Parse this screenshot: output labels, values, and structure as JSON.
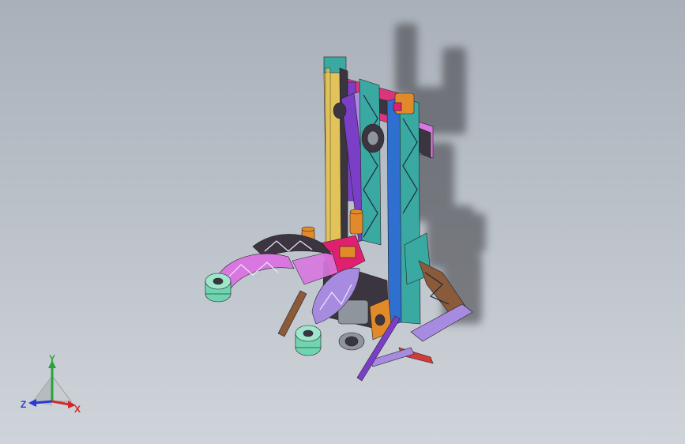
{
  "viewport": {
    "background_top": "#a9b0b9",
    "background_bottom": "#cfd4da"
  },
  "model": {
    "icon": "robot-assembly-model",
    "part_colors": {
      "column_blue": "#2f6fd0",
      "column_teal": "#3aa9a2",
      "column_yellow": "#e2c35a",
      "purple": "#7b3fc7",
      "magenta": "#e0206f",
      "pink": "#d877e0",
      "orange": "#e28a2a",
      "mint": "#6fd4b0",
      "red": "#d43a3a",
      "dark": "#3b3540",
      "brown": "#8a5a3a",
      "lavender": "#a78be0",
      "gray": "#8f959c"
    }
  },
  "shadow": {
    "color": "#3a3a3f"
  },
  "triad": {
    "icon": "view-orientation-triad-icon",
    "x_label": "X",
    "y_label": "Y",
    "z_label": "Z",
    "x_color": "#d12a2a",
    "y_color": "#2aa33a",
    "z_color": "#2a3ad1"
  }
}
